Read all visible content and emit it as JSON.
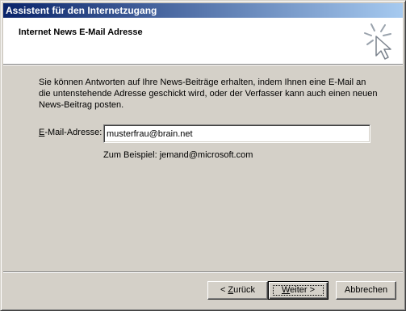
{
  "window": {
    "title": "Assistent für den Internetzugang"
  },
  "header": {
    "title": "Internet News E-Mail Adresse",
    "icon": "wizard-cursor-icon"
  },
  "main": {
    "description": "Sie können Antworten auf Ihre News-Beiträge erhalten, indem Ihnen eine E-Mail an die untenstehende Adresse geschickt wird, oder der Verfasser kann auch einen neuen News-Beitrag posten.",
    "email_label_accel": "E",
    "email_label_rest": "-Mail-Adresse:",
    "email_value": "musterfrau@brain.net",
    "example": "Zum Beispiel: jemand@microsoft.com"
  },
  "buttons": {
    "back_prefix": "< ",
    "back_accel": "Z",
    "back_rest": "urück",
    "next_accel": "W",
    "next_rest": "eiter >",
    "cancel": "Abbrechen"
  },
  "colors": {
    "titlebar_start": "#0a246a",
    "titlebar_end": "#a6caf0",
    "dialog_face": "#d4d0c8"
  }
}
